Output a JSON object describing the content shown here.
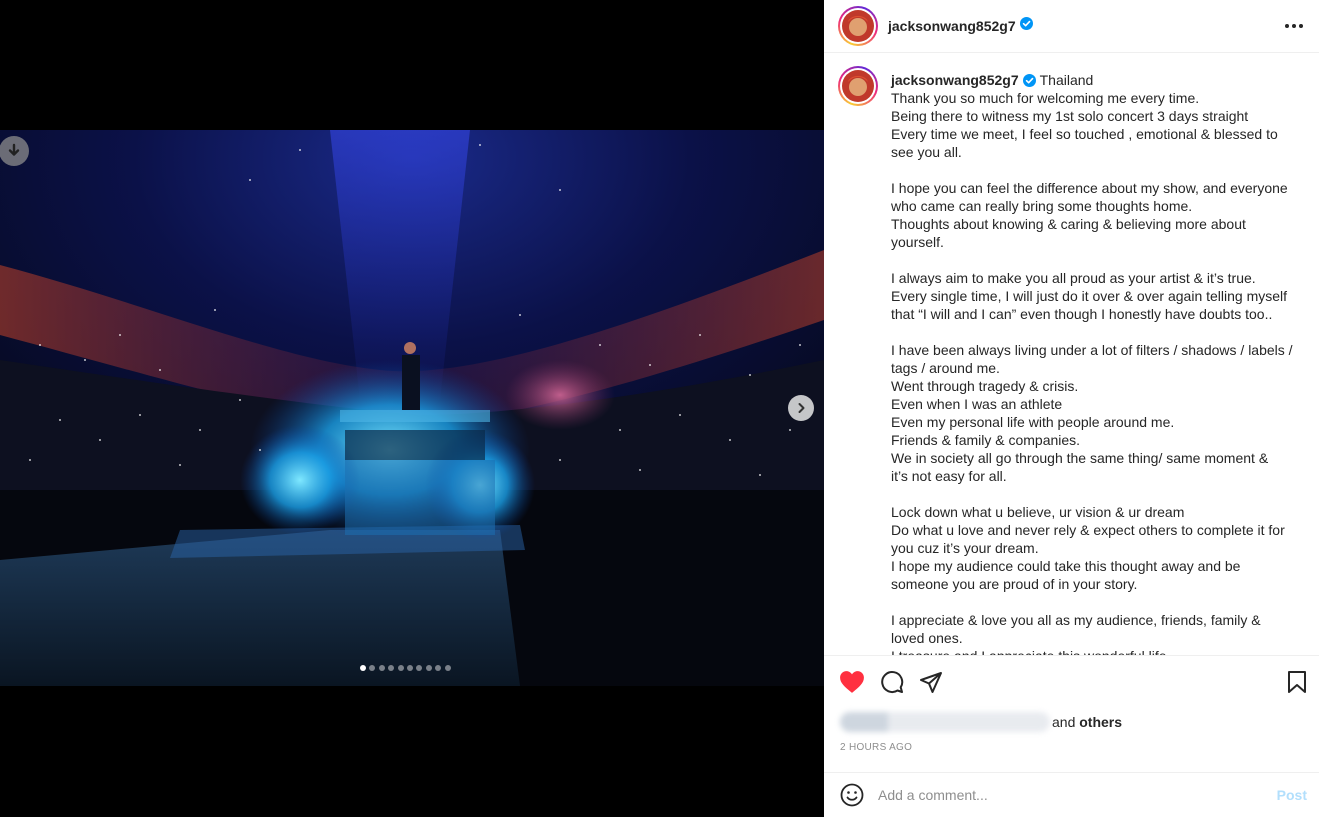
{
  "post": {
    "username": "jacksonwang852g7",
    "location": "Thailand",
    "caption_lines": [
      "Thank you so much for welcoming me every time.",
      "Being there to witness my 1st solo concert 3 days straight",
      "Every time we meet, I feel so touched , emotional & blessed to",
      "see you all.",
      "",
      "I hope you can feel the difference about my show, and everyone",
      "who came can really bring some thoughts home.",
      "Thoughts about knowing & caring & believing more about",
      "yourself.",
      "",
      "I always aim to make you all proud as your artist & it’s true.",
      "Every single time, I will just do it over & over again telling myself",
      "that “I will and I can” even though I honestly have doubts too..",
      "",
      "I have been always living under a lot of filters / shadows / labels /",
      "tags / around me.",
      "Went through tragedy & crisis.",
      "Even when I was an athlete",
      "Even my personal life with people around me.",
      "Friends & family & companies.",
      "We in society all go through the same thing/ same moment &",
      "it’s not easy for all.",
      "",
      "Lock down what u believe, ur vision & ur dream",
      "Do what u love and never rely & expect others to complete it for",
      "you cuz it’s your dream.",
      "I hope my audience could take this thought away and be",
      "someone you are proud of in your story.",
      "",
      "I appreciate & love you all as my audience, friends, family &",
      "loved ones.",
      "I treasure and I appreciate this wonderful life."
    ],
    "likes_suffix_pre": "and ",
    "likes_suffix_bold": "others",
    "timestamp": "2 HOURS AGO"
  },
  "media": {
    "slide_count": 10,
    "active_slide": 0,
    "icons": {
      "download": "download-icon",
      "next": "chevron-right-icon"
    }
  },
  "actions": {
    "icons": [
      "heart-filled-icon",
      "comment-icon",
      "share-icon",
      "bookmark-icon"
    ],
    "heart_color": "#ff3040"
  },
  "comment": {
    "placeholder": "Add a comment...",
    "post_label": "Post"
  },
  "colors": {
    "verified": "#0095f6",
    "post_disabled": "#b2dffc"
  }
}
